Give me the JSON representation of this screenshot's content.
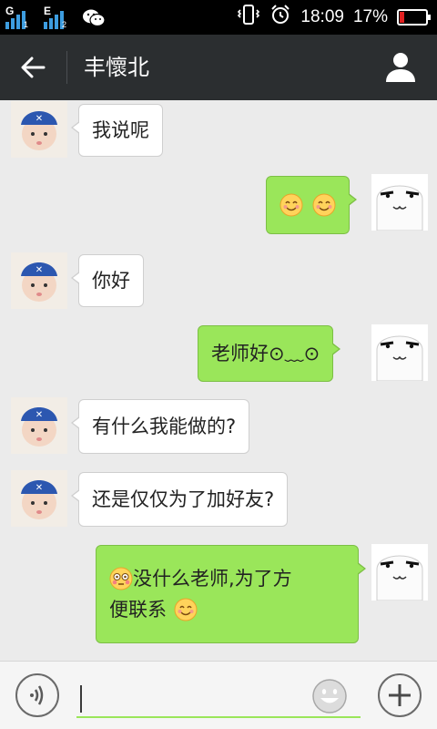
{
  "status_bar": {
    "sim1_network": "G",
    "sim1_slot": "1",
    "sim2_network": "E",
    "sim2_slot": "2",
    "time": "18:09",
    "battery": "17%",
    "battery_level": 0.17
  },
  "header": {
    "title": "丰懷北"
  },
  "messages": [
    {
      "side": "in",
      "text": "我说呢"
    },
    {
      "side": "out",
      "text": "",
      "emojis": [
        "smile",
        "smile"
      ]
    },
    {
      "side": "in",
      "text": "你好"
    },
    {
      "side": "out",
      "text": "老师好⊙﹏⊙"
    },
    {
      "side": "in",
      "text": "有什么我能做的?"
    },
    {
      "side": "in",
      "text": "还是仅仅为了加好友?"
    },
    {
      "side": "out",
      "line1": "没什么老师,为了方",
      "line2": "便联系",
      "emojis": [
        "flushed",
        "smile"
      ]
    }
  ],
  "input": {
    "value": "",
    "placeholder": ""
  },
  "icons": {
    "back": "arrow-left-icon",
    "profile": "person-icon",
    "voice": "voice-icon",
    "emoji": "smiley-icon",
    "more": "plus-icon"
  },
  "colors": {
    "outgoing_bubble": "#9ae65a",
    "incoming_bubble": "#ffffff",
    "title_bar": "#2b2e30",
    "background": "#ebebeb"
  }
}
